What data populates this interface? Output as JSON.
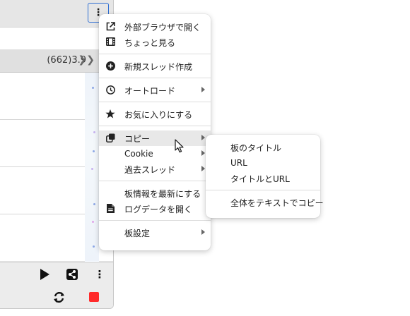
{
  "toolbar": {
    "more_glyph": "⋮"
  },
  "tabs": {
    "thread_stat": "(662)3.9",
    "chevron": "❯❯"
  },
  "main_menu": {
    "items": [
      {
        "label": "外部ブラウザで開く",
        "icon": "external-link-icon"
      },
      {
        "label": "ちょっと見る",
        "icon": "film-icon"
      },
      {
        "label": "新規スレッド作成",
        "icon": "add-circle-icon"
      },
      {
        "label": "オートロード",
        "icon": "clock-icon",
        "submenu": true
      },
      {
        "label": "お気に入りにする",
        "icon": "star-icon"
      },
      {
        "label": "コピー",
        "icon": "copy-icon",
        "submenu": true,
        "highlighted": true
      },
      {
        "label": "Cookie",
        "submenu": true
      },
      {
        "label": "過去スレッド",
        "submenu": true
      },
      {
        "label": "板情報を最新にする"
      },
      {
        "label": "ログデータを開く",
        "icon": "document-icon"
      },
      {
        "label": "板設定",
        "submenu": true
      }
    ]
  },
  "copy_submenu": {
    "items": [
      {
        "label": "板のタイトル"
      },
      {
        "label": "URL"
      },
      {
        "label": "タイトルとURL"
      },
      {
        "label": "全体をテキストでコピー"
      }
    ]
  },
  "bottom_bar": {
    "icons": [
      "play-icon",
      "share-icon",
      "more-vertical-icon",
      "refresh-icon",
      "stop-icon"
    ],
    "stop_color": "#ff2a2a"
  },
  "colors": {
    "focus_outline": "#2f6fd3",
    "menu_highlight": "#e8e8e8"
  }
}
